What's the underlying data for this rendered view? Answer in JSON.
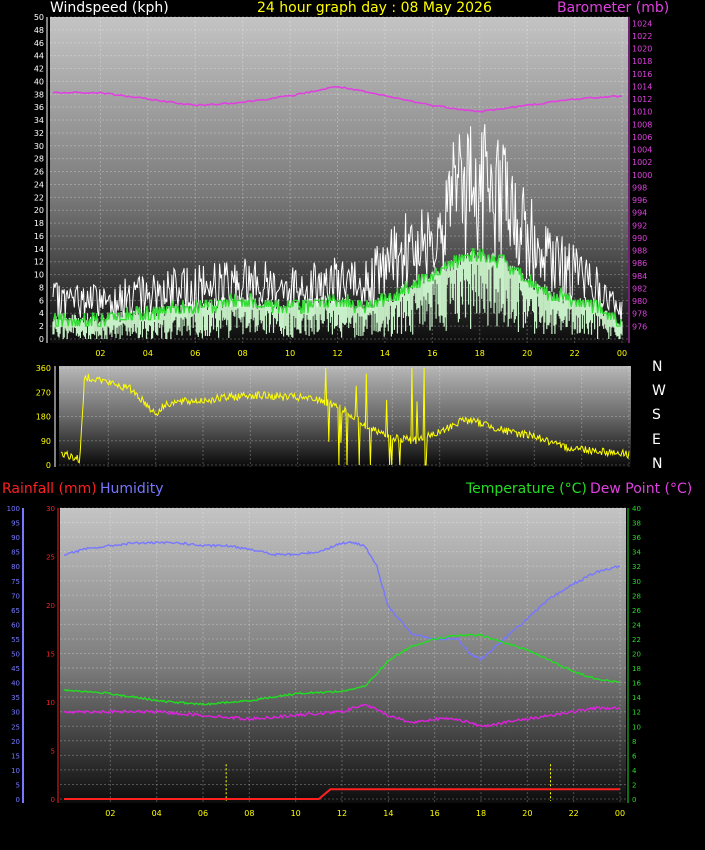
{
  "header": {
    "windspeed_label": "Windspeed (kph)",
    "title": "24 hour graph day : 08 May 2026",
    "barometer_label": "Barometer (mb)"
  },
  "direction_labels": [
    "N",
    "W",
    "S",
    "E",
    "N"
  ],
  "bottom_header": {
    "rainfall_label": "Rainfall (mm)",
    "humidity_label": "Humidity",
    "temperature_label": "Temperature (°C)",
    "dewpoint_label": "Dew Point (°C)"
  },
  "colors": {
    "windspeed_label": "#ffffff",
    "title": "#ffff00",
    "barometer": "#e040e0",
    "gust": "#ffffff",
    "avg_wind": "#33dd33",
    "wind_fill": "#c8f0c8",
    "direction": "#ffff00",
    "rainfall": "#ff2020",
    "humidity": "#7777ff",
    "temperature": "#22dd22",
    "dewpoint": "#dd22dd"
  },
  "chart_data": [
    {
      "type": "line",
      "title": "24 hour graph day : 08 May 2026",
      "x_ticks": [
        "02",
        "04",
        "06",
        "08",
        "10",
        "12",
        "14",
        "16",
        "18",
        "20",
        "22",
        "00"
      ],
      "ylabel": "Windspeed (kph)",
      "ylim": [
        0,
        50
      ],
      "y_ticks": [
        0,
        2,
        4,
        6,
        8,
        10,
        12,
        14,
        16,
        18,
        20,
        22,
        24,
        26,
        28,
        30,
        32,
        34,
        36,
        38,
        40,
        42,
        44,
        46,
        48,
        50
      ],
      "y2label": "Barometer (mb)",
      "y2lim": [
        974,
        1025
      ],
      "y2_ticks": [
        976,
        978,
        980,
        982,
        984,
        986,
        988,
        990,
        992,
        994,
        996,
        998,
        1000,
        1002,
        1004,
        1006,
        1008,
        1010,
        1012,
        1014,
        1016,
        1018,
        1020,
        1022,
        1024
      ],
      "grid": true,
      "series": [
        {
          "name": "Barometer (mb)",
          "axis": "right",
          "x": [
            0,
            2,
            4,
            6,
            8,
            10,
            12,
            14,
            16,
            18,
            20,
            22,
            24
          ],
          "values": [
            1013,
            1013,
            1012,
            1011,
            1011.5,
            1012.5,
            1014,
            1012.5,
            1011,
            1010,
            1011,
            1012,
            1012.5
          ]
        },
        {
          "name": "Gust",
          "axis": "left",
          "x": [
            0,
            2,
            4,
            6,
            8,
            10,
            12,
            13,
            14,
            15,
            16,
            17,
            18,
            19,
            20,
            21,
            22,
            23,
            24
          ],
          "values": [
            6,
            6,
            7,
            8,
            9,
            8,
            9,
            8,
            11,
            14,
            17,
            22,
            24,
            22,
            16,
            12,
            10,
            8,
            4
          ]
        },
        {
          "name": "Average",
          "axis": "left",
          "x": [
            0,
            2,
            4,
            6,
            8,
            10,
            12,
            13,
            14,
            15,
            16,
            17,
            18,
            19,
            20,
            21,
            22,
            23,
            24
          ],
          "values": [
            3,
            3,
            4,
            5,
            6,
            5,
            6,
            5,
            6,
            8,
            10,
            12,
            13,
            12,
            9,
            7,
            6,
            5,
            2
          ]
        }
      ]
    },
    {
      "type": "line",
      "ylabel": "",
      "ylim": [
        0,
        360
      ],
      "y_ticks": [
        0,
        90,
        180,
        270,
        360
      ],
      "grid": true,
      "series": [
        {
          "name": "Wind direction",
          "x": [
            0,
            0.8,
            1,
            1.5,
            3,
            4,
            4.5,
            6,
            8,
            10,
            11,
            12,
            13,
            14,
            15,
            16,
            17,
            18,
            19,
            20,
            21,
            22,
            23,
            24
          ],
          "values": [
            45,
            20,
            330,
            320,
            280,
            190,
            230,
            240,
            260,
            250,
            240,
            200,
            140,
            100,
            90,
            120,
            170,
            150,
            120,
            110,
            70,
            60,
            50,
            40
          ]
        }
      ]
    },
    {
      "type": "line",
      "x_ticks": [
        "02",
        "04",
        "06",
        "08",
        "10",
        "12",
        "14",
        "16",
        "18",
        "20",
        "22",
        "00"
      ],
      "ylim": [
        0,
        30
      ],
      "y_ticks": [
        0,
        5,
        10,
        15,
        20,
        25,
        30
      ],
      "ylim_humidity": [
        0,
        100
      ],
      "humidity_ticks": [
        0,
        5,
        10,
        15,
        20,
        25,
        30,
        35,
        40,
        45,
        50,
        55,
        60,
        65,
        70,
        75,
        80,
        85,
        90,
        95,
        100
      ],
      "y2lim": [
        0,
        40
      ],
      "y2_ticks": [
        0,
        2,
        4,
        6,
        8,
        10,
        12,
        14,
        16,
        18,
        20,
        22,
        24,
        26,
        28,
        30,
        32,
        34,
        36,
        38,
        40
      ],
      "grid": true,
      "series": [
        {
          "name": "Humidity",
          "axis": "humidity",
          "x": [
            0,
            1,
            2,
            3,
            4,
            5,
            6,
            7,
            8,
            9,
            10,
            11,
            12,
            12.5,
            13,
            13.5,
            14,
            15,
            16,
            17,
            17.5,
            18,
            19,
            20,
            21,
            22,
            23,
            24
          ],
          "values": [
            84,
            86,
            87,
            88,
            88,
            88,
            87,
            87,
            86,
            84,
            84,
            85,
            88,
            88,
            87,
            80,
            66,
            57,
            55,
            55,
            50,
            48,
            55,
            62,
            69,
            74,
            78,
            80
          ]
        },
        {
          "name": "Temperature (°C)",
          "axis": "right",
          "x": [
            0,
            2,
            4,
            6,
            8,
            10,
            12,
            13,
            14,
            15,
            16,
            17,
            18,
            19,
            20,
            21,
            22,
            23,
            24
          ],
          "values": [
            15,
            14.5,
            13.5,
            13,
            13.5,
            14.5,
            14.8,
            15.5,
            19,
            21,
            22,
            22.5,
            22.5,
            21.5,
            20.5,
            19,
            17.5,
            16.5,
            16
          ]
        },
        {
          "name": "Dew Point (°C)",
          "axis": "right",
          "x": [
            0,
            2,
            4,
            6,
            8,
            10,
            12,
            13,
            14,
            15,
            16,
            17,
            18,
            19,
            20,
            21,
            22,
            23,
            24
          ],
          "values": [
            12,
            12,
            12,
            11.5,
            11,
            11.5,
            12,
            13,
            11.5,
            10.5,
            11,
            11,
            10,
            10.5,
            11,
            11.5,
            12,
            12.5,
            12.5
          ]
        },
        {
          "name": "Rainfall (mm)",
          "axis": "left",
          "x": [
            0,
            11,
            11.5,
            24
          ],
          "values": [
            0,
            0,
            1,
            1
          ]
        }
      ]
    }
  ]
}
